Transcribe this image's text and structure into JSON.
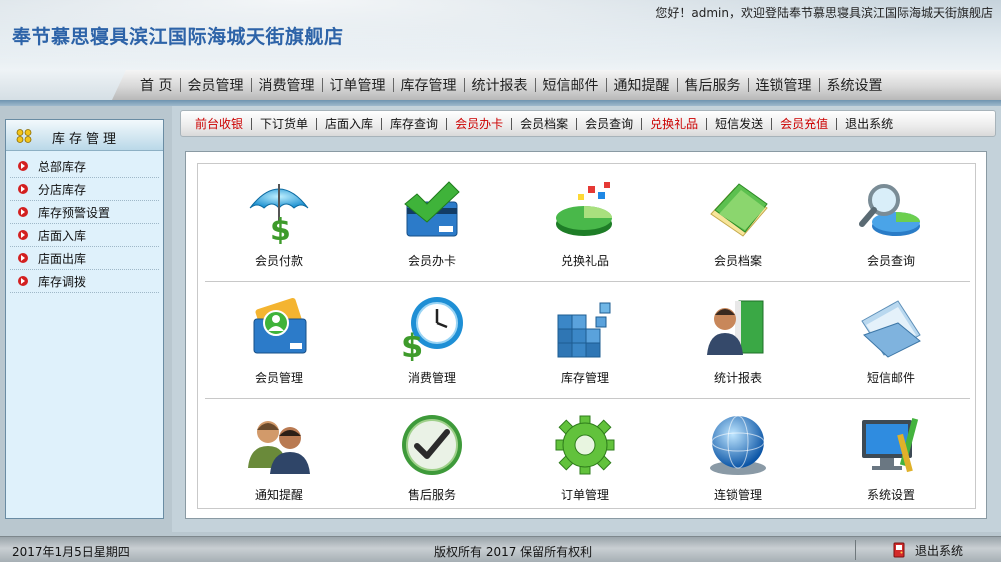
{
  "header": {
    "title": "奉节慕思寝具滨江国际海城天街旗舰店",
    "welcome": "您好！admin，欢迎登陆奉节慕思寝具滨江国际海城天街旗舰店"
  },
  "nav": {
    "items": [
      "首 页",
      "会员管理",
      "消费管理",
      "订单管理",
      "库存管理",
      "统计报表",
      "短信邮件",
      "通知提醒",
      "售后服务",
      "连锁管理",
      "系统设置"
    ]
  },
  "sidebar": {
    "title": "库存管理",
    "items": [
      "总部库存",
      "分店库存",
      "库存预警设置",
      "店面入库",
      "店面出库",
      "库存调拨"
    ]
  },
  "quickbar": {
    "items": [
      {
        "label": "前台收银",
        "color": "#cc0000"
      },
      {
        "label": "下订货单",
        "color": "#111111"
      },
      {
        "label": "店面入库",
        "color": "#111111"
      },
      {
        "label": "库存查询",
        "color": "#111111"
      },
      {
        "label": "会员办卡",
        "color": "#cc0000"
      },
      {
        "label": "会员档案",
        "color": "#111111"
      },
      {
        "label": "会员查询",
        "color": "#111111"
      },
      {
        "label": "兑换礼品",
        "color": "#cc0000"
      },
      {
        "label": "短信发送",
        "color": "#111111"
      },
      {
        "label": "会员充值",
        "color": "#cc0000"
      },
      {
        "label": "退出系统",
        "color": "#111111"
      }
    ]
  },
  "tiles": [
    {
      "label": "会员付款",
      "icon": "umbrella-dollar-icon"
    },
    {
      "label": "会员办卡",
      "icon": "card-check-icon"
    },
    {
      "label": "兑换礼品",
      "icon": "pie-chart-icon"
    },
    {
      "label": "会员档案",
      "icon": "folder-icon"
    },
    {
      "label": "会员查询",
      "icon": "magnifier-icon"
    },
    {
      "label": "会员管理",
      "icon": "member-card-icon"
    },
    {
      "label": "消费管理",
      "icon": "clock-dollar-icon"
    },
    {
      "label": "库存管理",
      "icon": "cubes-icon"
    },
    {
      "label": "统计报表",
      "icon": "person-book-icon"
    },
    {
      "label": "短信邮件",
      "icon": "mail-folder-icon"
    },
    {
      "label": "通知提醒",
      "icon": "users-icon"
    },
    {
      "label": "售后服务",
      "icon": "checkmark-icon"
    },
    {
      "label": "订单管理",
      "icon": "gear-icon"
    },
    {
      "label": "连锁管理",
      "icon": "globe-icon"
    },
    {
      "label": "系统设置",
      "icon": "monitor-tools-icon"
    }
  ],
  "footer": {
    "date": "2017年1月5日星期四",
    "copyright": "版权所有 2017 保留所有权利",
    "exit_label": "退出系统"
  }
}
